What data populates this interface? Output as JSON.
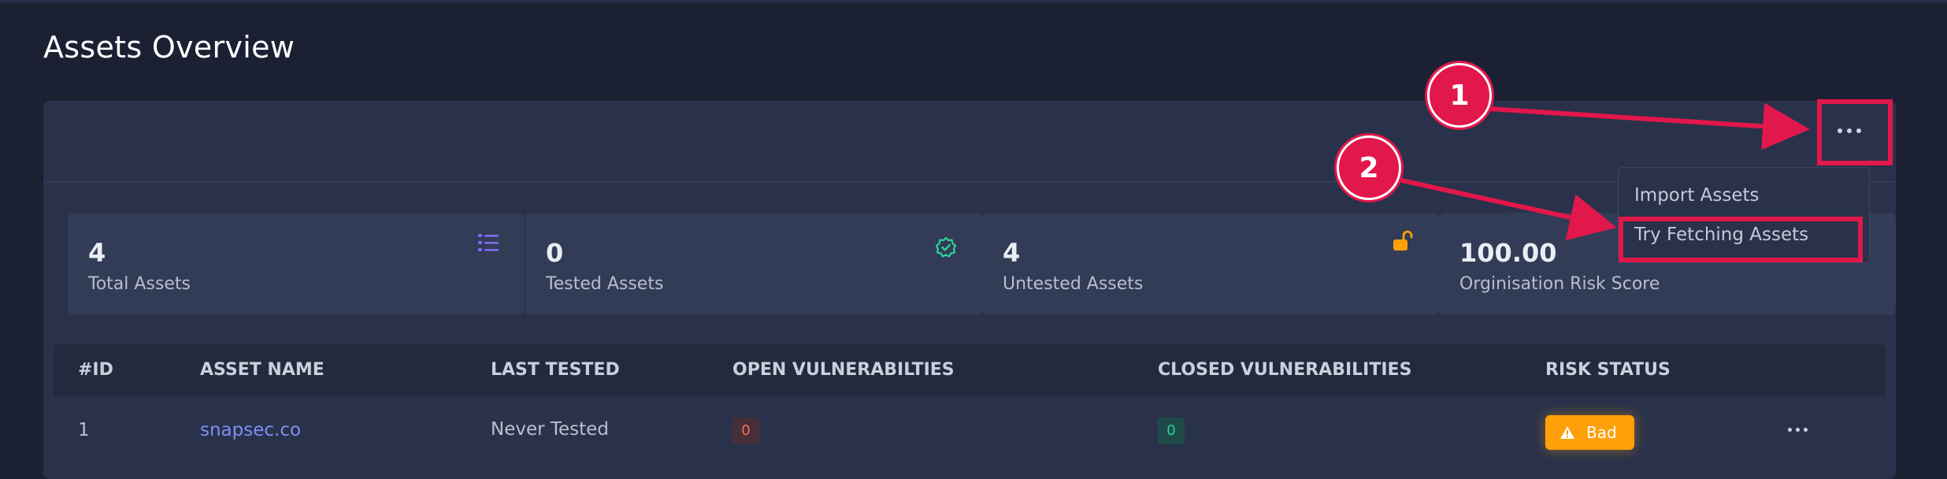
{
  "page": {
    "title": "Assets Overview"
  },
  "stats": [
    {
      "value": "4",
      "label": "Total Assets",
      "icon": "list-icon"
    },
    {
      "value": "0",
      "label": "Tested Assets",
      "icon": "shield-check-icon"
    },
    {
      "value": "4",
      "label": "Untested Assets",
      "icon": "unlock-icon"
    },
    {
      "value": "100.00",
      "label": "Orginisation Risk Score",
      "icon": ""
    }
  ],
  "menu": {
    "items": [
      "Import Assets",
      "Try Fetching Assets"
    ]
  },
  "table": {
    "headers": [
      "#ID",
      "ASSET NAME",
      "LAST TESTED",
      "OPEN VULNERABILTIES",
      "CLOSED VULNERABILITIES",
      "RISK STATUS"
    ],
    "rows": [
      {
        "id": "1",
        "asset_name": "snapsec.co",
        "last_tested": "Never Tested",
        "open_vulns": "0",
        "closed_vulns": "0",
        "risk_status": "Bad"
      }
    ]
  },
  "annotations": {
    "step1": "1",
    "step2": "2"
  },
  "colors": {
    "background": "#1b2133",
    "panel": "#29324a",
    "card": "#323c56",
    "accent_link": "#7f8ff0",
    "risk_bad": "#ff9f0a",
    "open_vuln": "#ff6b5a",
    "closed_vuln": "#2fd39a",
    "annotation": "#e2174b"
  }
}
